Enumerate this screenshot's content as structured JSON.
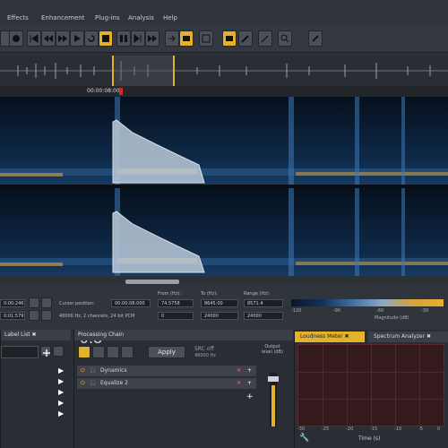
{
  "menu": [
    "Effects",
    "Enhancement",
    "Plug-ins",
    "Analysis",
    "Help"
  ],
  "timeline": {
    "marker": "00:00:08:00"
  },
  "info": {
    "cursor_label": "Cursor position:",
    "time_a": "00:00:08:000",
    "format": "48000 Hz, 2 channels, 24 bit PCM",
    "from_label": "From (Hz):",
    "from_values": [
      "74.5758",
      "0"
    ],
    "to_label": "To (Hz):",
    "to_values": [
      "8645.00",
      "24000"
    ],
    "range_label": "Range (Hz):",
    "range_values": [
      "8571.4",
      "24000"
    ],
    "left_values": [
      "0:00:246",
      "0:01:579"
    ],
    "scale_title": "Magnitude (dB)",
    "scale_ticks": [
      "-120",
      "-90",
      "-60",
      "-30"
    ]
  },
  "label_panel": {
    "title": "Label List"
  },
  "chain": {
    "title": "Processing Chain",
    "apply": "Apply",
    "src_label": "SRC off",
    "src_rate": "48000 Hz",
    "output_label": "Output level (dB)",
    "output_value": "-0.8",
    "items": [
      "Dynamics",
      "Equalize 2"
    ]
  },
  "meter": {
    "tab1": "Loudness Meter",
    "tab2": "Spectrum Analyzer",
    "x_ticks": [
      "-30",
      "-25",
      "-20",
      "-15",
      "-10",
      "-5",
      "0"
    ],
    "xlabel": "Time (s)"
  },
  "colors": {
    "accent": "#e3b12a",
    "panel": "#2a2d33"
  }
}
